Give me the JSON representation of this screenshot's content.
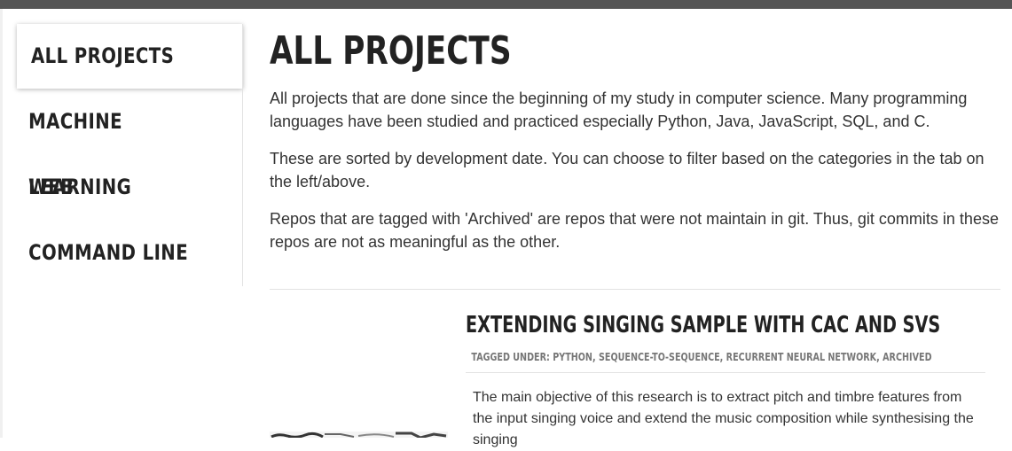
{
  "sidebar": {
    "items": [
      {
        "label": "ALL PROJECTS",
        "active": true
      },
      {
        "label": "MACHINE LEARNING"
      },
      {
        "label": "WEB"
      },
      {
        "label": "COMMAND LINE"
      }
    ]
  },
  "main": {
    "title": "ALL PROJECTS",
    "paragraphs": [
      "All projects that are done since the beginning of my study in computer science. Many programming languages have been studied and practiced especially Python, Java, JavaScript, SQL, and C.",
      "These are sorted by development date. You can choose to filter based on the categories in the tab on the left/above.",
      "Repos that are tagged with 'Archived' are repos that were not maintain in git. Thus, git commits in these repos are not as meaningful as the other."
    ]
  },
  "project": {
    "title": "EXTENDING SINGING SAMPLE WITH CAC AND SVS",
    "tagged_label": "TAGGED UNDER:",
    "tags": [
      "PYTHON",
      "SEQUENCE-TO-SEQUENCE",
      "RECURRENT NEURAL NETWORK",
      "ARCHIVED"
    ],
    "description": "The main objective of this research is to extract pitch and timbre features from the input singing voice and extend the music composition while synthesising the singing"
  }
}
